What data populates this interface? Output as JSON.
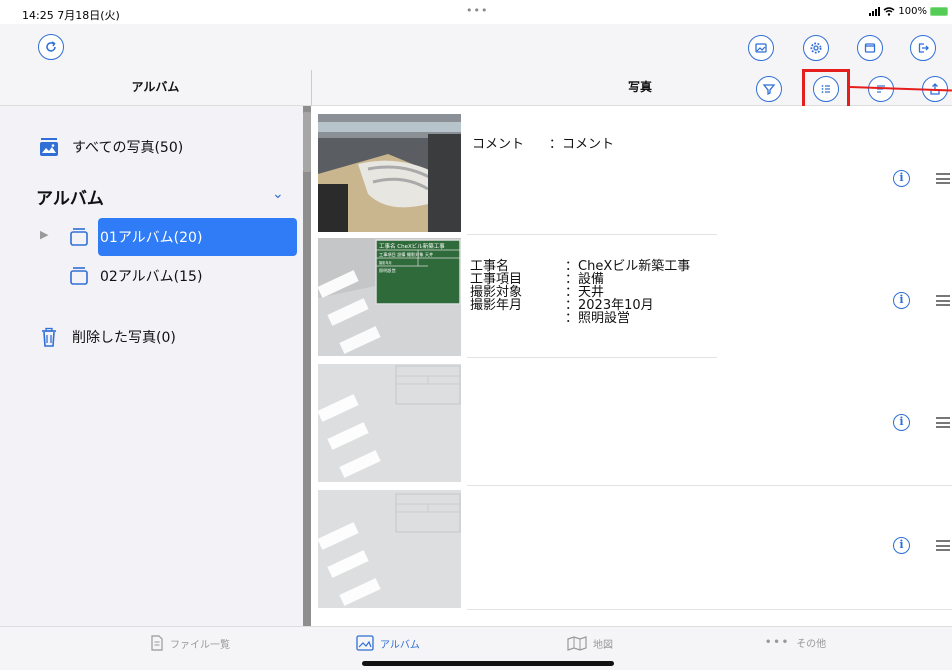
{
  "status_bar": {
    "time": "14:25",
    "date": "7月18日(火)",
    "dots": "•••",
    "battery_text": "100%"
  },
  "toolbar": {
    "refresh_icon": "refresh-icon",
    "right_icons": [
      "photo-album-icon",
      "settings-gear-icon",
      "window-icon",
      "logout-icon"
    ]
  },
  "header": {
    "album_title": "アルバム",
    "photo_title": "写真",
    "icons": [
      "filter-icon",
      "list-icon",
      "sort-icon",
      "share-icon"
    ]
  },
  "sidebar": {
    "all_photos": "すべての写真(50)",
    "album_section": "アルバム",
    "albums": [
      {
        "label": "01アルバム(20)",
        "selected": true
      },
      {
        "label": "02アルバム(15)",
        "selected": false
      }
    ],
    "deleted": "削除した写真(0)"
  },
  "photos": [
    {
      "fields": [
        {
          "label": "コメント",
          "value": "：コメント"
        }
      ]
    },
    {
      "fields": [
        {
          "label": "工事名",
          "value": "：CheXビル新築工事"
        },
        {
          "label": "工事項目",
          "value": "：設備"
        },
        {
          "label": "撮影対象",
          "value": "：天井"
        },
        {
          "label": "撮影年月",
          "value": "：2023年10月"
        },
        {
          "label": "",
          "value": "：照明設営"
        }
      ],
      "board": {
        "title": "工事名  CheXビル新築工事",
        "row1": "工事項目 設備  撮影対象 天井",
        "row2": "撮影年月",
        "row3": "照明設営"
      }
    },
    {
      "fields": []
    },
    {
      "fields": []
    }
  ],
  "tabs": [
    {
      "label": "ファイル一覧",
      "icon": "document-icon",
      "active": false
    },
    {
      "label": "アルバム",
      "icon": "album-icon",
      "active": true
    },
    {
      "label": "地図",
      "icon": "map-icon",
      "active": false
    },
    {
      "label": "その他",
      "icon": "more-icon",
      "active": false
    }
  ],
  "colors": {
    "accent": "#2f6fd6",
    "selected_bg": "#2f7cf6",
    "highlight": "#e51d1d"
  }
}
